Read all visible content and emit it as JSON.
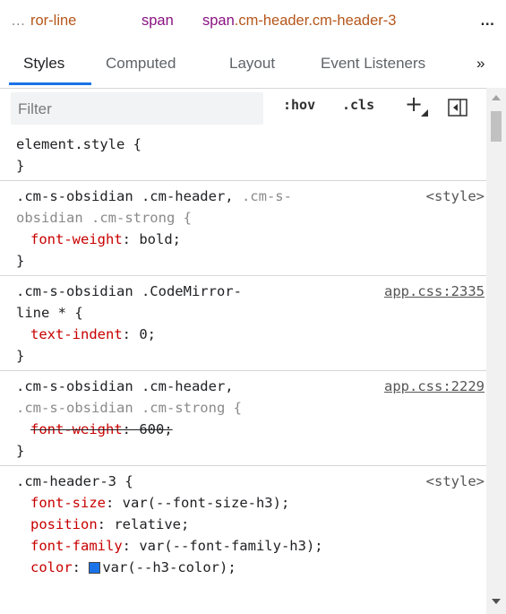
{
  "breadcrumb": {
    "ellipsis_left": "…",
    "items": [
      "ror-line",
      "span",
      "span.cm-header.cm-header-3"
    ],
    "ellipsis_right": "…"
  },
  "tabs": [
    {
      "label": "Styles",
      "active": true
    },
    {
      "label": "Computed"
    },
    {
      "label": "Layout"
    },
    {
      "label": "Event Listeners"
    }
  ],
  "tabs_more": "»",
  "toolbar": {
    "filter_placeholder": "Filter",
    "hov": ":hov",
    "cls": ".cls",
    "new_rule": "+"
  },
  "rules": [
    {
      "selector_lines": [
        "element.style {"
      ],
      "declarations": [],
      "close": "}"
    },
    {
      "selector_line1_a": ".cm-s-obsidian .cm-header,",
      "selector_line1_b": " .cm-s-",
      "selector_line2": "obsidian .cm-strong {",
      "source": "<style>",
      "declarations": [
        {
          "prop": "font-weight",
          "value": "bold;"
        }
      ],
      "close": "}"
    },
    {
      "selector_line1": ".cm-s-obsidian .CodeMirror-",
      "selector_line2": "line * {",
      "source": "app.css:2335",
      "declarations": [
        {
          "prop": "text-indent",
          "value": "0;"
        }
      ],
      "close": "}"
    },
    {
      "selector_line1": ".cm-s-obsidian .cm-header,",
      "selector_line2": ".cm-s-obsidian .cm-strong {",
      "source": "app.css:2229",
      "declarations": [
        {
          "prop": "font-weight",
          "value": "600;"
        }
      ],
      "close": "}"
    },
    {
      "selector_line1": ".cm-header-3 {",
      "source": "<style>",
      "declarations": [
        {
          "prop": "font-size",
          "value": "var(--font-size-h3);"
        },
        {
          "prop": "position",
          "value": "relative;"
        },
        {
          "prop": "font-family",
          "value": "var(--font-family-h3);"
        },
        {
          "prop": "color",
          "value": "var(--h3-color);"
        }
      ]
    }
  ],
  "colors": {
    "accent": "#1a73e8",
    "property": "#c80000",
    "breadcrumb_text": "#b5561b",
    "breadcrumb_tag": "#881280"
  }
}
